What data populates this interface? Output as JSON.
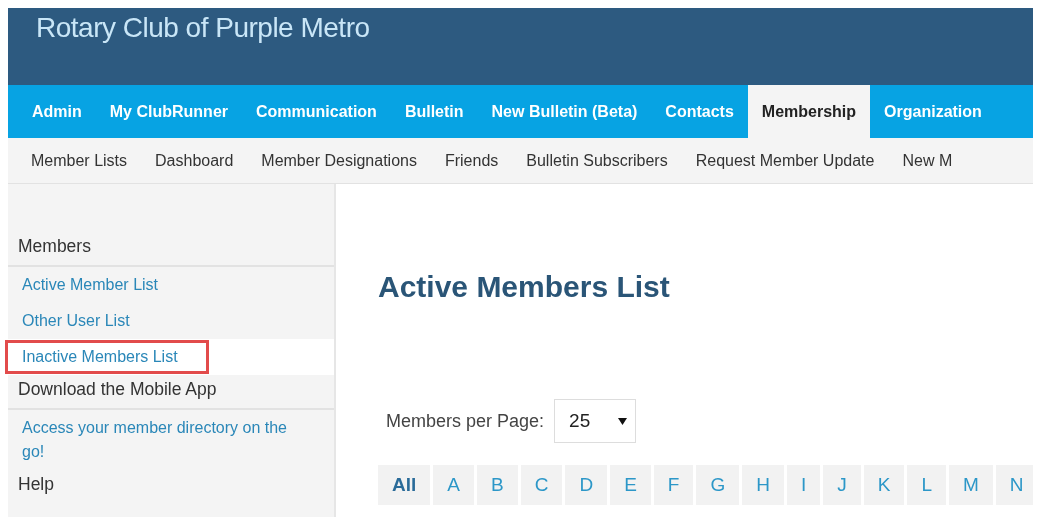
{
  "header": {
    "title": "Rotary Club of Purple Metro"
  },
  "nav": [
    {
      "label": "Admin",
      "selected": false
    },
    {
      "label": "My ClubRunner",
      "selected": false
    },
    {
      "label": "Communication",
      "selected": false
    },
    {
      "label": "Bulletin",
      "selected": false
    },
    {
      "label": "New Bulletin (Beta)",
      "selected": false
    },
    {
      "label": "Contacts",
      "selected": false
    },
    {
      "label": "Membership",
      "selected": true
    },
    {
      "label": "Organization",
      "selected": false
    }
  ],
  "subnav": [
    "Member Lists",
    "Dashboard",
    "Member Designations",
    "Friends",
    "Bulletin Subscribers",
    "Request Member Update",
    "New M"
  ],
  "sidebar": [
    {
      "heading": "Members",
      "items": [
        {
          "label": "Active Member List",
          "selected": false
        },
        {
          "label": "Other User List",
          "selected": false
        },
        {
          "label": "Inactive Members List",
          "selected": true
        }
      ]
    },
    {
      "heading": "Download the Mobile App",
      "items": [
        {
          "label": "Access your member directory on the go!",
          "selected": false
        }
      ]
    },
    {
      "heading": "Help"
    }
  ],
  "content": {
    "title": "Active Members List",
    "per_page_label": "Members per Page:",
    "per_page_value": "25",
    "letters": [
      {
        "label": "All",
        "selected": true
      },
      {
        "label": "A",
        "selected": false
      },
      {
        "label": "B",
        "selected": false
      },
      {
        "label": "C",
        "selected": false
      },
      {
        "label": "D",
        "selected": false
      },
      {
        "label": "E",
        "selected": false
      },
      {
        "label": "F",
        "selected": false
      },
      {
        "label": "G",
        "selected": false
      },
      {
        "label": "H",
        "selected": false
      },
      {
        "label": "I",
        "selected": false
      },
      {
        "label": "J",
        "selected": false
      },
      {
        "label": "K",
        "selected": false
      },
      {
        "label": "L",
        "selected": false
      },
      {
        "label": "M",
        "selected": false
      },
      {
        "label": "N",
        "selected": false
      }
    ]
  }
}
